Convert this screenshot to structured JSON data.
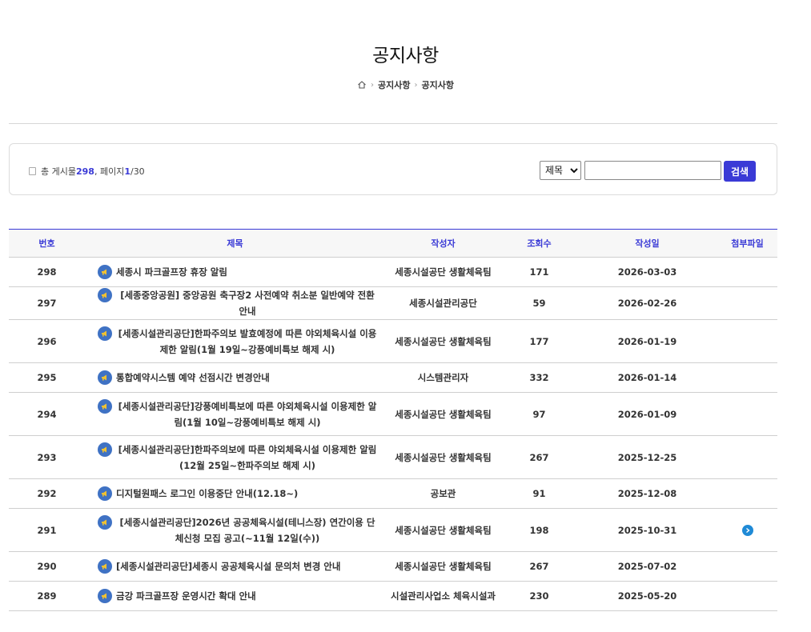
{
  "header": {
    "title": "공지사항",
    "breadcrumb": [
      "공지사항",
      "공지사항"
    ]
  },
  "summary": {
    "prefix": "총 게시물 ",
    "total": "298",
    "mid": ", 페이지 ",
    "current_page": "1",
    "sep": " / ",
    "total_pages": "30"
  },
  "search": {
    "field_options": [
      "제목"
    ],
    "selected": "제목",
    "query": "",
    "button_label": "검색"
  },
  "table": {
    "columns": [
      "번호",
      "제목",
      "작성자",
      "조회수",
      "작성일",
      "첨부파일"
    ],
    "rows": [
      {
        "no": "298",
        "title": "세종시 파크골프장 휴장 알림",
        "author": "세종시설공단 생활체육팀",
        "views": "171",
        "date": "2026-03-03",
        "attachment": false
      },
      {
        "no": "297",
        "title": "[세종중앙공원] 중앙공원 축구장2 사전예약 취소분 일반예약 전환 안내",
        "author": "세종시설관리공단",
        "views": "59",
        "date": "2026-02-26",
        "attachment": false
      },
      {
        "no": "296",
        "title": "[세종시설관리공단]한파주의보 발효예정에 따른 야외체육시설 이용제한 알림(1월 19일~강풍예비특보 해제 시)",
        "author": "세종시설공단 생활체육팀",
        "views": "177",
        "date": "2026-01-19",
        "attachment": false
      },
      {
        "no": "295",
        "title": "통합예약시스템 예약 선점시간 변경안내",
        "author": "시스템관리자",
        "views": "332",
        "date": "2026-01-14",
        "attachment": false
      },
      {
        "no": "294",
        "title": "[세종시설관리공단]강풍예비특보에 따른 야외체육시설 이용제한 알림(1월 10일~강풍예비특보 해제 시)",
        "author": "세종시설공단 생활체육팀",
        "views": "97",
        "date": "2026-01-09",
        "attachment": false
      },
      {
        "no": "293",
        "title": "[세종시설관리공단]한파주의보에 따른 야외체육시설 이용제한 알림(12월 25일~한파주의보 해제 시)",
        "author": "세종시설공단 생활체육팀",
        "views": "267",
        "date": "2025-12-25",
        "attachment": false
      },
      {
        "no": "292",
        "title": "디지털원패스 로그인 이용중단 안내(12.18~)",
        "author": "공보관",
        "views": "91",
        "date": "2025-12-08",
        "attachment": false
      },
      {
        "no": "291",
        "title": "[세종시설관리공단]2026년 공공체육시설(테니스장) 연간이용 단체신청 모집 공고(~11월 12일(수))",
        "author": "세종시설공단 생활체육팀",
        "views": "198",
        "date": "2025-10-31",
        "attachment": true
      },
      {
        "no": "290",
        "title": "[세종시설관리공단]세종시 공공체육시설 문의처 변경 안내",
        "author": "세종시설공단 생활체육팀",
        "views": "267",
        "date": "2025-07-02",
        "attachment": false
      },
      {
        "no": "289",
        "title": "금강 파크골프장 운영시간 확대 안내",
        "author": "시설관리사업소 체육시설과",
        "views": "230",
        "date": "2025-05-20",
        "attachment": false
      }
    ]
  },
  "icons": {
    "home": "home-icon",
    "notice": "megaphone-icon",
    "attachment": "file-download-icon"
  },
  "colors": {
    "accent": "#3a3ad6",
    "notice_icon": "#3f72c4",
    "attachment_icon": "#1f8ad6"
  }
}
